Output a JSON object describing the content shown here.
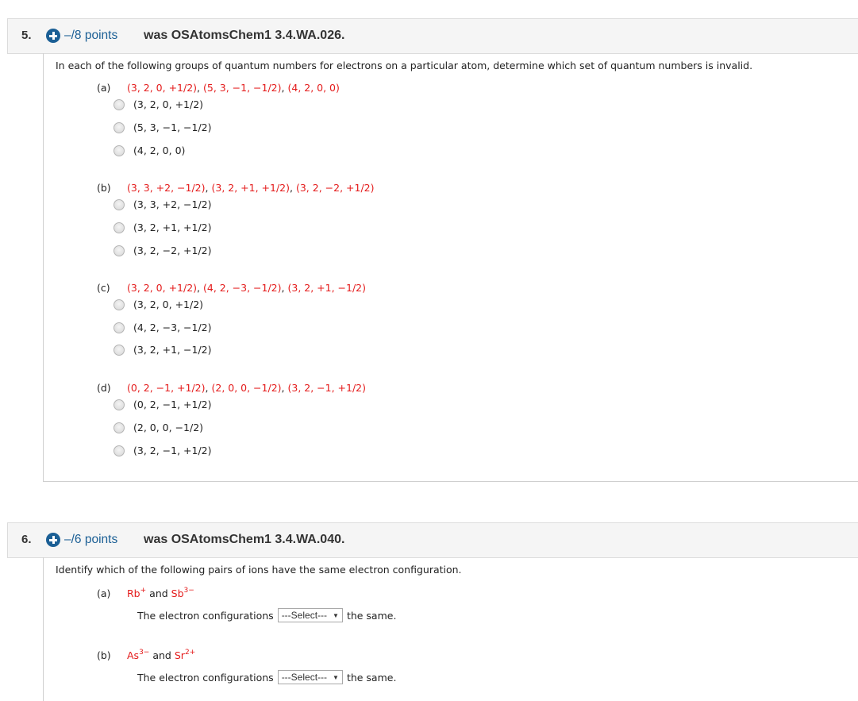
{
  "questions": [
    {
      "number": "5.",
      "points": "–/8 points",
      "was": "was OSAtomsChem1 3.4.WA.026.",
      "prompt": "In each of the following groups of quantum numbers for electrons on a particular atom, determine which set of quantum numbers is invalid.",
      "parts": [
        {
          "label": "(a)",
          "sets": [
            "(3, 2, 0, +1/2)",
            "(5, 3, −1, −1/2)",
            "(4, 2, 0, 0)"
          ],
          "options": [
            "(3, 2, 0, +1/2)",
            "(5, 3, −1, −1/2)",
            "(4, 2, 0, 0)"
          ]
        },
        {
          "label": "(b)",
          "sets": [
            "(3, 3, +2, −1/2)",
            "(3, 2, +1, +1/2)",
            "(3, 2, −2, +1/2)"
          ],
          "options": [
            "(3, 3, +2, −1/2)",
            "(3, 2, +1, +1/2)",
            "(3, 2, −2, +1/2)"
          ]
        },
        {
          "label": "(c)",
          "sets": [
            "(3, 2, 0, +1/2)",
            "(4, 2, −3, −1/2)",
            "(3, 2, +1, −1/2)"
          ],
          "options": [
            "(3, 2, 0, +1/2)",
            "(4, 2, −3, −1/2)",
            "(3, 2, +1, −1/2)"
          ]
        },
        {
          "label": "(d)",
          "sets": [
            "(0, 2, −1, +1/2)",
            "(2, 0, 0, −1/2)",
            "(3, 2, −1, +1/2)"
          ],
          "options": [
            "(0, 2, −1, +1/2)",
            "(2, 0, 0, −1/2)",
            "(3, 2, −1, +1/2)"
          ]
        }
      ],
      "separator": ", "
    },
    {
      "number": "6.",
      "points": "–/6 points",
      "was": "was OSAtomsChem1 3.4.WA.040.",
      "prompt": "Identify which of the following pairs of ions have the same electron configuration.",
      "connector": "and",
      "parts": [
        {
          "label": "(a)",
          "ion1": "Rb",
          "ion1_charge": "+",
          "ion2": "Sb",
          "ion2_charge": "3−",
          "sentence_before": "The electron configurations",
          "select_value": "---Select---",
          "sentence_after": "the same."
        },
        {
          "label": "(b)",
          "ion1": "As",
          "ion1_charge": "3−",
          "ion2": "Sr",
          "ion2_charge": "2+",
          "sentence_before": "The electron configurations",
          "select_value": "---Select---",
          "sentence_after": "the same."
        }
      ]
    }
  ],
  "colors": {
    "accent": "#1b5f95",
    "answer_red": "#e41b1b",
    "header_bg": "#f5f5f5"
  }
}
